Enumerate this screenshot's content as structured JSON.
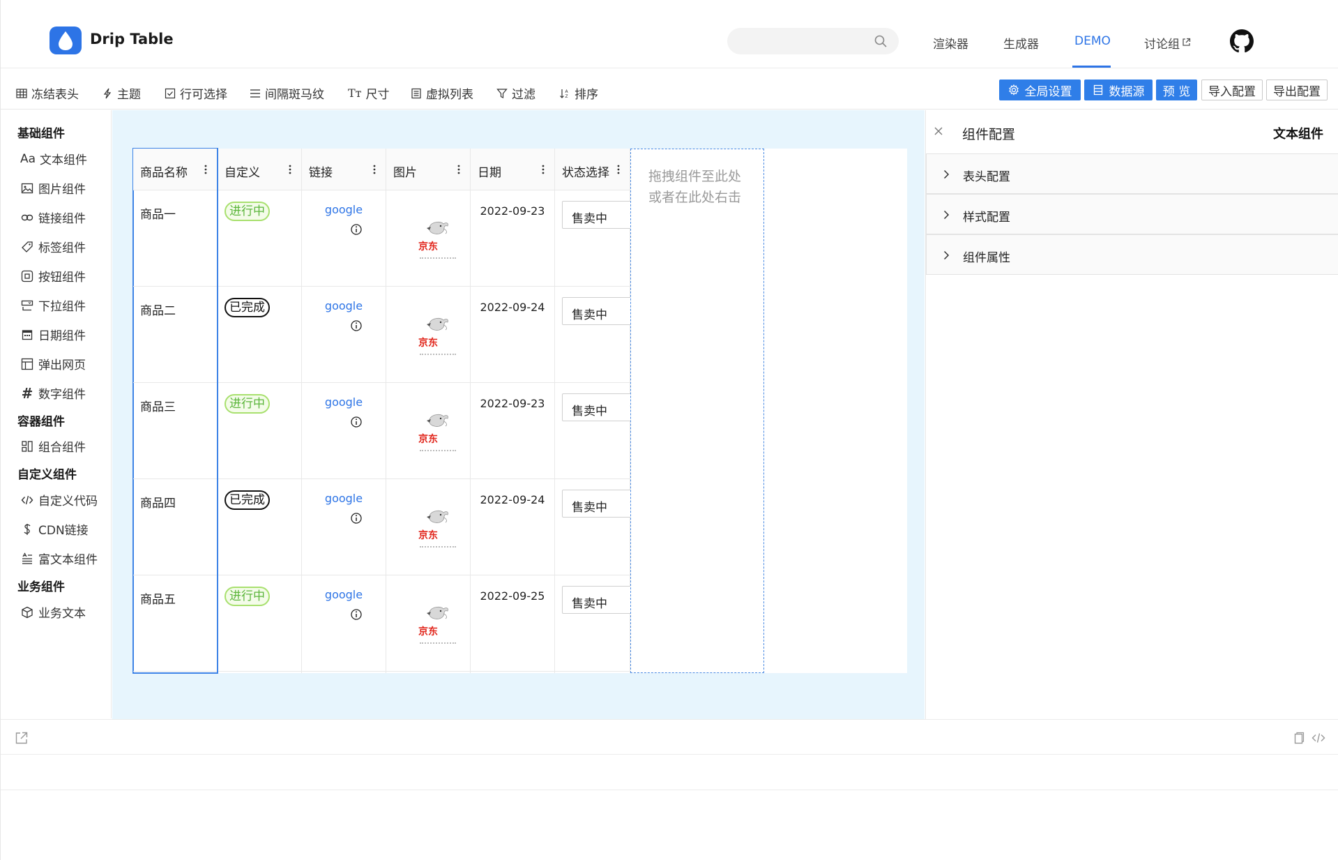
{
  "header": {
    "brand": "Drip Table",
    "search": {
      "placeholder": ""
    },
    "nav": [
      {
        "label": "渲染器",
        "active": false
      },
      {
        "label": "生成器",
        "active": false
      },
      {
        "label": "DEMO",
        "active": true
      },
      {
        "label": "讨论组",
        "active": false,
        "external": true
      }
    ],
    "github_icon": "github-icon"
  },
  "toolbar": {
    "tools": [
      {
        "label": "冻结表头",
        "icon": "table-icon"
      },
      {
        "label": "主题",
        "icon": "theme-icon"
      },
      {
        "label": "行可选择",
        "icon": "checkbox-icon"
      },
      {
        "label": "间隔斑马纹",
        "icon": "stripe-icon"
      },
      {
        "label": "尺寸",
        "icon": "font-size-icon",
        "prefix": "Tт"
      },
      {
        "label": "虚拟列表",
        "icon": "list-icon"
      },
      {
        "label": "过滤",
        "icon": "filter-icon"
      },
      {
        "label": "排序",
        "icon": "sort-icon"
      }
    ],
    "buttons": {
      "global_settings": "全局设置",
      "data_source": "数据源",
      "preview": "预 览",
      "import": "导入配置",
      "export": "导出配置"
    }
  },
  "sidebar": {
    "groups": {
      "basic": "基础组件",
      "container": "容器组件",
      "custom": "自定义组件",
      "business": "业务组件"
    },
    "basic_items": [
      {
        "label": "文本组件",
        "icon": "text-icon",
        "glyph": "Aa"
      },
      {
        "label": "图片组件",
        "icon": "image-icon"
      },
      {
        "label": "链接组件",
        "icon": "link-icon"
      },
      {
        "label": "标签组件",
        "icon": "tag-icon"
      },
      {
        "label": "按钮组件",
        "icon": "button-icon"
      },
      {
        "label": "下拉组件",
        "icon": "dropdown-icon"
      },
      {
        "label": "日期组件",
        "icon": "calendar-icon"
      },
      {
        "label": "弹出网页",
        "icon": "popup-icon"
      },
      {
        "label": "数字组件",
        "icon": "number-icon",
        "glyph": "#"
      }
    ],
    "container_items": [
      {
        "label": "组合组件",
        "icon": "group-icon"
      }
    ],
    "custom_items": [
      {
        "label": "自定义代码",
        "icon": "code-icon"
      },
      {
        "label": "CDN链接",
        "icon": "cdn-icon"
      },
      {
        "label": "富文本组件",
        "icon": "rich-text-icon"
      }
    ],
    "business_items": [
      {
        "label": "业务文本",
        "icon": "box-icon"
      }
    ]
  },
  "table": {
    "columns": [
      "商品名称",
      "自定义",
      "链接",
      "图片",
      "日期",
      "状态选择"
    ],
    "rows": [
      {
        "name": "商品一",
        "status": "进行中",
        "status_color": "green",
        "link": "google",
        "image_caption": "京东",
        "date": "2022-09-23",
        "select": "售卖中"
      },
      {
        "name": "商品二",
        "status": "已完成",
        "status_color": "black",
        "link": "google",
        "image_caption": "京东",
        "date": "2022-09-24",
        "select": "售卖中"
      },
      {
        "name": "商品三",
        "status": "进行中",
        "status_color": "green",
        "link": "google",
        "image_caption": "京东",
        "date": "2022-09-23",
        "select": "售卖中"
      },
      {
        "name": "商品四",
        "status": "已完成",
        "status_color": "black",
        "link": "google",
        "image_caption": "京东",
        "date": "2022-09-24",
        "select": "售卖中"
      },
      {
        "name": "商品五",
        "status": "进行中",
        "status_color": "green",
        "link": "google",
        "image_caption": "京东",
        "date": "2022-09-25",
        "select": "售卖中"
      }
    ],
    "drop_zone_text": "拖拽组件至此处或者在此处右击"
  },
  "panel": {
    "title": "组件配置",
    "subtitle": "文本组件",
    "sections": [
      "表头配置",
      "样式配置",
      "组件属性"
    ]
  },
  "colors": {
    "accent": "#2d74e6",
    "button_primary": "#2f7ee8",
    "canvas_bg": "#e7f5fd",
    "tag_green": "#5ab53a",
    "jd_red": "#e1251b"
  }
}
